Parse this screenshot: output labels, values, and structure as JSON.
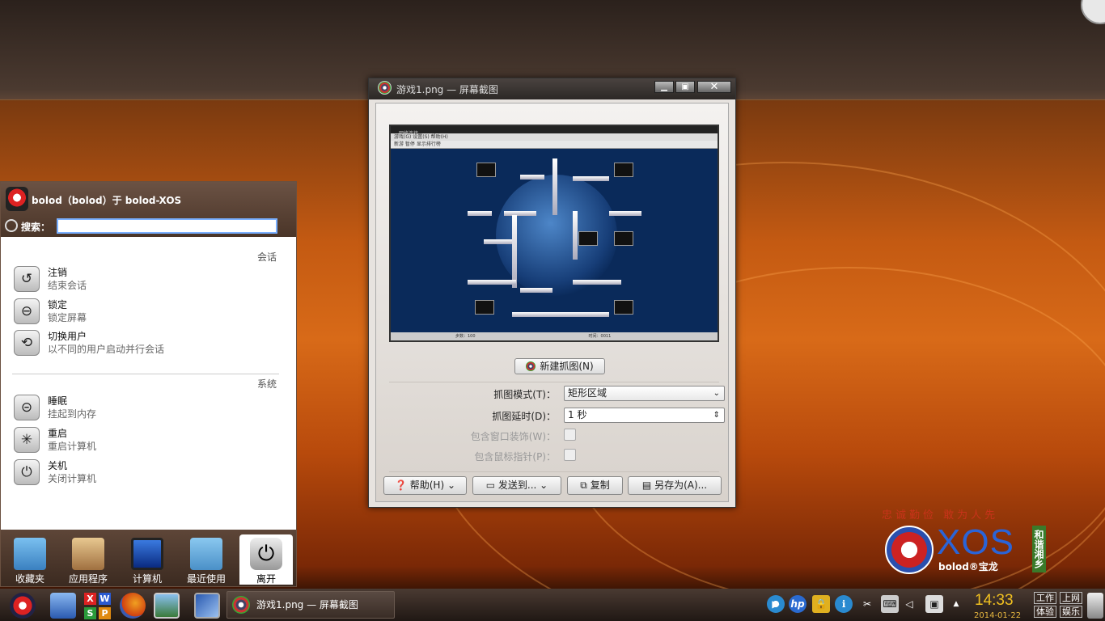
{
  "kickoff": {
    "user_line": "bolod（bolod）于 bolod-XOS",
    "search_label": "搜索：",
    "search_value": "",
    "session_header": "会话",
    "system_header": "系统",
    "session_items": [
      {
        "title": "注销",
        "desc": "结束会话",
        "icon": "logout-icon"
      },
      {
        "title": "锁定",
        "desc": "锁定屏幕",
        "icon": "lock-icon"
      },
      {
        "title": "切换用户",
        "desc": "以不同的用户启动并行会话",
        "icon": "switch-user-icon"
      }
    ],
    "system_items": [
      {
        "title": "睡眠",
        "desc": "挂起到内存",
        "icon": "sleep-icon"
      },
      {
        "title": "重启",
        "desc": "重启计算机",
        "icon": "restart-icon"
      },
      {
        "title": "关机",
        "desc": "关闭计算机",
        "icon": "shutdown-icon"
      }
    ],
    "tabs": [
      "收藏夹",
      "应用程序",
      "计算机",
      "最近使用",
      "离开"
    ],
    "active_tab": "离开"
  },
  "window": {
    "title": "游戏1.png — 屏幕截图",
    "new_capture": "新建抓图(N)",
    "capture_mode_label": "抓图模式(T)：",
    "capture_mode_value": "矩形区域",
    "delay_label": "抓图延时(D)：",
    "delay_value": "1 秒",
    "include_decor_label": "包含窗口装饰(W)：",
    "include_cursor_label": "包含鼠标指针(P)：",
    "help": "帮助(H)",
    "send_to": "发送到...",
    "copy": "复制",
    "save_as": "另存为(A)...",
    "preview": {
      "title": "网络连接",
      "menu": "游戏(G)  设置(S)  帮助(H)",
      "toolbar": "新游  暂停  显示排行榜",
      "status_left": "步数：100",
      "status_right": "时间：0011"
    }
  },
  "branding": {
    "slogan": "忠诚勤俭  敢为人先",
    "product": "XOS",
    "sub": "bolod®宝龙",
    "tag": "和谐湘乡"
  },
  "taskbar": {
    "task_title": "游戏1.png — 屏幕截图",
    "office_letters": [
      "X",
      "W",
      "S",
      "P"
    ],
    "time": "14:33",
    "date": "2014-01-22",
    "activities": [
      "工作",
      "上网",
      "体验",
      "娱乐"
    ]
  },
  "colors": {
    "accent": "#c45a12",
    "clock": "#f0c020",
    "search_border": "#7ab0ff"
  }
}
